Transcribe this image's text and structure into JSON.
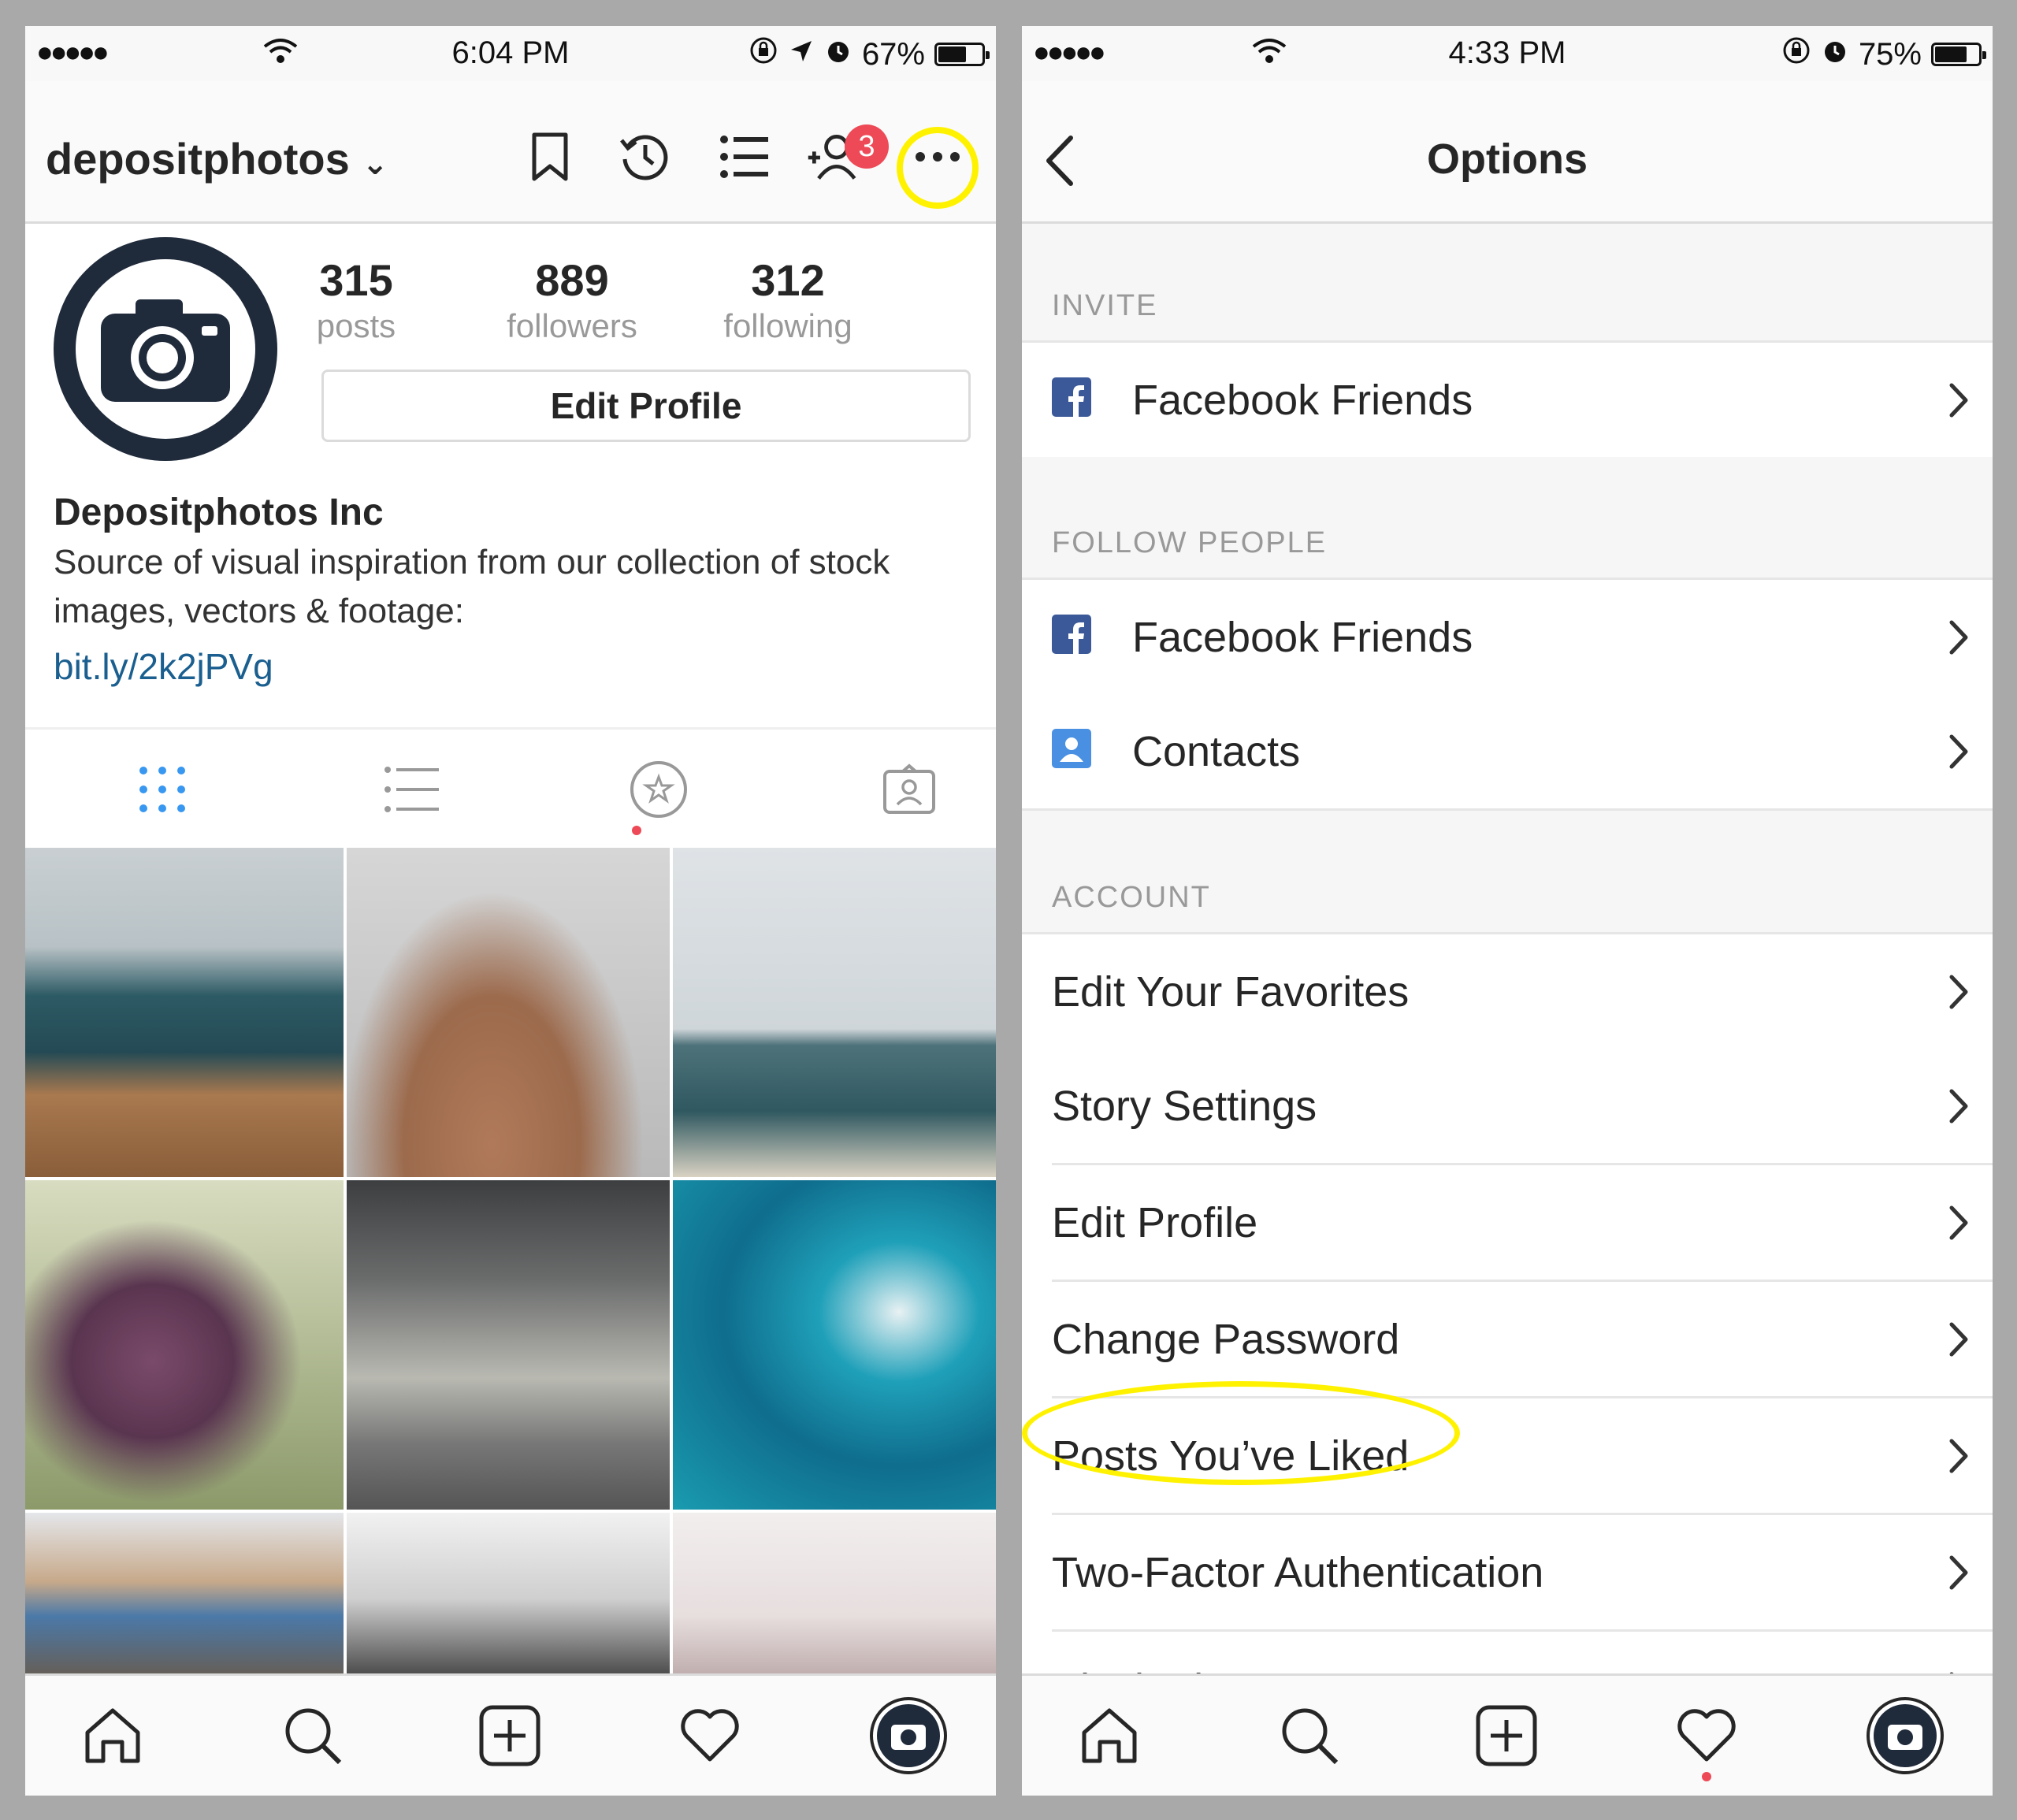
{
  "left": {
    "status": {
      "signal": "●●●●●",
      "time": "6:04 PM",
      "battery_pct": "67%",
      "battery_level": 0.67
    },
    "header": {
      "username": "depositphotos",
      "notification_count": "3"
    },
    "profile": {
      "posts_count": "315",
      "posts_label": "posts",
      "followers_count": "889",
      "followers_label": "followers",
      "following_count": "312",
      "following_label": "following",
      "edit_button": "Edit Profile",
      "full_name": "Depositphotos Inc",
      "bio": "Source of visual inspiration from our collection of stock images, vectors & footage:",
      "link": "bit.ly/2k2jPVg"
    },
    "icons": [
      "grid-icon",
      "list-icon",
      "star-icon",
      "tagged-icon",
      "bookmark-icon",
      "history-icon",
      "add-person-icon",
      "more-icon"
    ]
  },
  "right": {
    "status": {
      "signal": "●●●●●",
      "time": "4:33 PM",
      "battery_pct": "75%",
      "battery_level": 0.75
    },
    "header": {
      "title": "Options"
    },
    "sections": {
      "invite": "INVITE",
      "follow_people": "FOLLOW PEOPLE",
      "account": "ACCOUNT"
    },
    "rows": {
      "invite_facebook": "Facebook Friends",
      "follow_facebook": "Facebook Friends",
      "contacts": "Contacts",
      "edit_favorites": "Edit Your Favorites",
      "story_settings": "Story Settings",
      "edit_profile": "Edit Profile",
      "change_password": "Change Password",
      "posts_liked": "Posts You’ve Liked",
      "two_factor": "Two-Factor Authentication",
      "blocked_users": "Blocked Users"
    }
  },
  "colors": {
    "highlight": "#fff200",
    "badge": "#ed4956",
    "facebook": "#3b5998",
    "link": "#1a5f8f",
    "active_tab": "#3897f0"
  }
}
